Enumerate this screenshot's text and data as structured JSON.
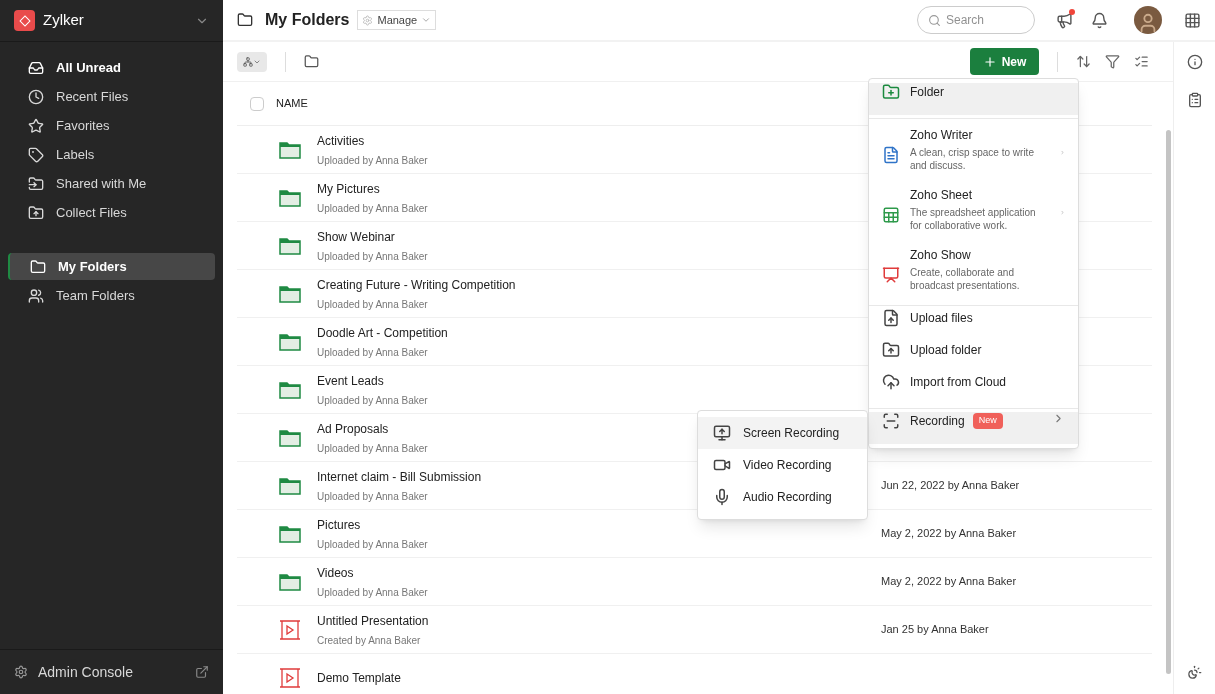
{
  "org": {
    "name": "Zylker"
  },
  "sidebar": {
    "items": [
      {
        "label": "All Unread",
        "selected": false,
        "bold": true
      },
      {
        "label": "Recent Files",
        "selected": false,
        "bold": false
      },
      {
        "label": "Favorites",
        "selected": false,
        "bold": false
      },
      {
        "label": "Labels",
        "selected": false,
        "bold": false
      },
      {
        "label": "Shared with Me",
        "selected": false,
        "bold": false
      },
      {
        "label": "Collect Files",
        "selected": false,
        "bold": false
      }
    ],
    "folders": [
      {
        "label": "My Folders",
        "selected": true
      },
      {
        "label": "Team Folders",
        "selected": false
      }
    ],
    "footer": "Admin Console"
  },
  "header": {
    "title": "My Folders",
    "manage": "Manage",
    "search_placeholder": "Search",
    "notification_dot": true
  },
  "toolbar": {
    "new_button": "New"
  },
  "table": {
    "name_column": "NAME",
    "select_all_checked": false,
    "rows": [
      {
        "kind": "folder",
        "name": "Activities",
        "subtitle": "Uploaded by Anna Baker"
      },
      {
        "kind": "folder",
        "name": "My Pictures",
        "subtitle": "Uploaded by Anna Baker"
      },
      {
        "kind": "folder",
        "name": "Show Webinar",
        "subtitle": "Uploaded by Anna Baker"
      },
      {
        "kind": "folder",
        "name": "Creating Future - Writing Competition",
        "subtitle": "Uploaded by Anna Baker"
      },
      {
        "kind": "folder",
        "name": "Doodle Art - Competition",
        "subtitle": "Uploaded by Anna Baker"
      },
      {
        "kind": "folder",
        "name": "Event Leads",
        "subtitle": "Uploaded by Anna Baker"
      },
      {
        "kind": "folder",
        "name": "Ad Proposals",
        "subtitle": "Uploaded by Anna Baker"
      },
      {
        "kind": "folder",
        "name": "Internet claim - Bill Submission",
        "subtitle": "Uploaded by Anna Baker",
        "date": "Jun 22, 2022 by Anna Baker"
      },
      {
        "kind": "folder",
        "name": "Pictures",
        "subtitle": "Uploaded by Anna Baker",
        "date": "May 2, 2022 by Anna Baker"
      },
      {
        "kind": "folder",
        "name": "Videos",
        "subtitle": "Uploaded by Anna Baker",
        "date": "May 2, 2022 by Anna Baker"
      },
      {
        "kind": "presentation",
        "name": "Untitled Presentation",
        "subtitle": "Created by Anna Baker",
        "date": "Jan 25 by Anna Baker"
      },
      {
        "kind": "presentation",
        "name": "Demo Template"
      }
    ]
  },
  "new_menu": {
    "items": [
      {
        "kind": "folder",
        "label": "Folder",
        "selected": true
      },
      {
        "kind": "writer",
        "label": "Zoho Writer",
        "description": "A clean, crisp space to write and discuss.",
        "selected": false
      },
      {
        "kind": "sheet",
        "label": "Zoho Sheet",
        "description": "The spreadsheet application for collaborative work.",
        "selected": false
      },
      {
        "kind": "show",
        "label": "Zoho Show",
        "description": "Create, collaborate and broadcast presentations.",
        "selected": false
      },
      {
        "kind": "upload_files",
        "label": "Upload files",
        "selected": false
      },
      {
        "kind": "upload_folder",
        "label": "Upload folder",
        "selected": false
      },
      {
        "kind": "cloud",
        "label": "Import from Cloud",
        "selected": false
      },
      {
        "kind": "recording",
        "label": "Recording",
        "badge": "New",
        "selected": true
      }
    ]
  },
  "recording_menu": {
    "items": [
      {
        "kind": "screen",
        "label": "Screen Recording",
        "selected": true
      },
      {
        "kind": "video",
        "label": "Video Recording",
        "selected": false
      },
      {
        "kind": "audio",
        "label": "Audio Recording",
        "selected": false
      }
    ]
  }
}
